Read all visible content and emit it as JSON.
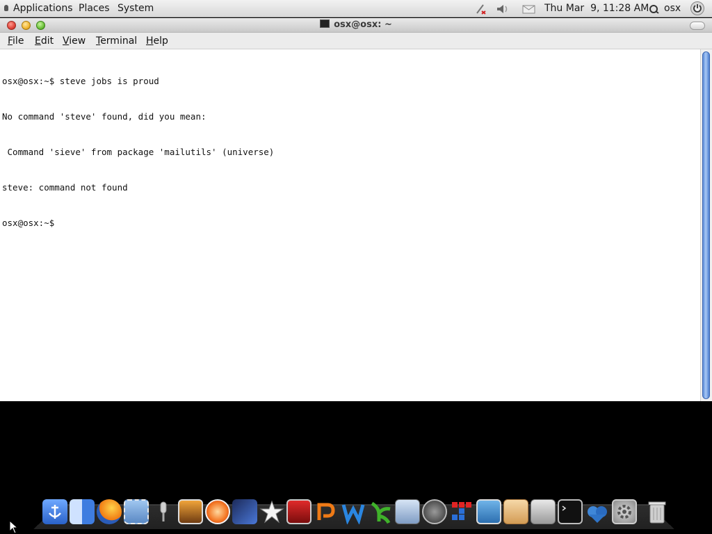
{
  "top_panel": {
    "menus": [
      "Applications",
      "Places",
      "System"
    ],
    "clock": "Thu Mar  9, 11:28 AM",
    "user": "osx",
    "tray_icons": [
      "network-icon",
      "volume-icon",
      "mail-icon"
    ]
  },
  "window": {
    "title": "osx@osx: ~",
    "menu": [
      "File",
      "Edit",
      "View",
      "Terminal",
      "Help"
    ]
  },
  "terminal": {
    "lines": [
      "osx@osx:~$ steve jobs is proud",
      "No command 'steve' found, did you mean:",
      " Command 'sieve' from package 'mailutils' (universe)",
      "steve: command not found",
      "osx@osx:~$ "
    ]
  },
  "dock": {
    "icons": [
      "anchor-icon",
      "finder-icon",
      "firefox-icon",
      "mail-stamp-icon",
      "microphone-icon",
      "photo-icon",
      "music-disc-icon",
      "clapper-icon",
      "star-icon",
      "video-strip-icon",
      "pages-icon",
      "word-icon",
      "sprout-icon",
      "system-panel-icon",
      "speaker-icon",
      "blocks-icon",
      "camera-icon",
      "files-icon",
      "utility-icon",
      "terminal-icon",
      "hearts-icon",
      "gear-icon",
      "trash-icon"
    ]
  },
  "colors": {
    "panel": "#dcdcdc",
    "terminal_bg": "#ffffff",
    "scroll_thumb": "#6f9ae0",
    "desktop": "#000000"
  }
}
